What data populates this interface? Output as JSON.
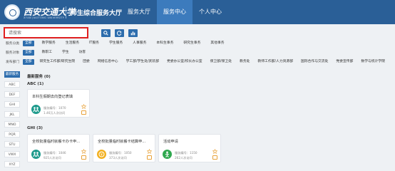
{
  "header": {
    "logo_text": "西安交通大学",
    "logo_sub": "XI'AN JIAOTONG UNIVERSITY",
    "hall_title": "师生综合服务大厅",
    "nav": [
      {
        "label": "服务大厅",
        "active": false
      },
      {
        "label": "服务中心",
        "active": true
      },
      {
        "label": "个人中心",
        "active": false
      }
    ]
  },
  "search": {
    "placeholder": "请搜索"
  },
  "filters": {
    "category": {
      "label": "服务分类",
      "options": [
        "全部",
        "教学服务",
        "生活服务",
        "IT服务",
        "学生服务",
        "人事服务",
        "本科生事务",
        "研究生事务",
        "其他事务"
      ],
      "selected": "全部"
    },
    "audience": {
      "label": "服务对象",
      "options": [
        "全部",
        "教职工",
        "学生",
        "访客"
      ],
      "selected": "全部"
    },
    "department": {
      "label": "发布部门",
      "options": [
        "全部",
        "研究生工作部/研究生院",
        "团委",
        "网络信息中心",
        "学工部/学生处/武装部",
        "党委办公室/校长办公室",
        "保卫部/保卫处",
        "教务处",
        "教师工作部/人力资源部",
        "国际合作与交流处",
        "党委宣传部",
        "数学与统计学院"
      ],
      "selected": "全部"
    }
  },
  "sidebar": {
    "head": "最新服务",
    "items": [
      "ABC",
      "DEF",
      "GHI",
      "JKL",
      "MNO",
      "PQR",
      "STU",
      "VWX",
      "XYZ"
    ]
  },
  "main": {
    "latest": "最新服务 (0)",
    "group_abc": "ABC (1)",
    "group_ghi": "GHI (3)",
    "cards": [
      {
        "title": "本科生假期去向登记表填",
        "number": "服务编号：1070",
        "views": "1.46万人次访问",
        "icon_color": "#1e9a8c"
      },
      {
        "title": "全校批量临时就餐卡办卡申...",
        "number": "服务编号：1046",
        "views": "925人次访问",
        "icon_color": "#1e9a8c"
      },
      {
        "title": "全校批量临时就餐卡结算申...",
        "number": "服务编号：1050",
        "views": "373人次访问",
        "icon_color": "#f2b01e"
      },
      {
        "title": "活动申请",
        "number": "服务编号：1150",
        "views": "262人次访问",
        "icon_color": "#2fa84f"
      }
    ]
  }
}
